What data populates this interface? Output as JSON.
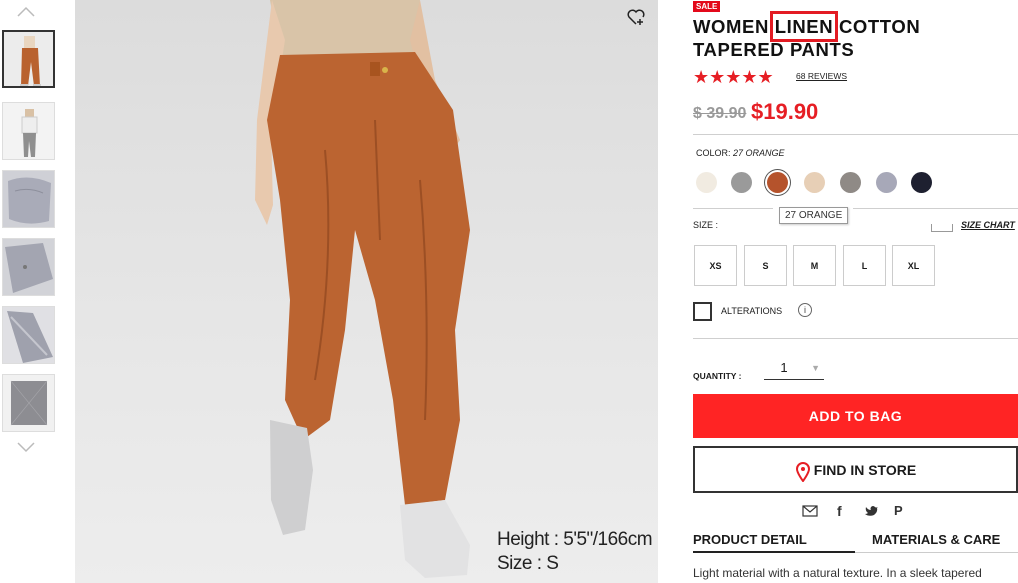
{
  "thumbnails": {
    "up_arrow": "^",
    "down_arrow": "v",
    "count": 6
  },
  "hero": {
    "caption_height": "Height : 5'5\"/166cm",
    "caption_size": "Size : S"
  },
  "product": {
    "sale_badge": "SALE",
    "title_before": "WOMEN ",
    "title_highlight": "LINEN",
    "title_after": " COTTON TAPERED PANTS",
    "stars": "★★★★★",
    "reviews": "68 REVIEWS",
    "old_price": "$ 39.90",
    "price": "$19.90"
  },
  "color": {
    "label": "COLOR:",
    "selected": "27 ORANGE",
    "tooltip": "27 ORANGE",
    "swatches": [
      "#f1ebe1",
      "#9a9a9a",
      "#b5532c",
      "#e7cfb6",
      "#8f8a86",
      "#a7a8b8",
      "#1e2030"
    ]
  },
  "size": {
    "label": "SIZE :",
    "chart_link": "SIZE CHART",
    "options": [
      "XS",
      "S",
      "M",
      "L",
      "XL"
    ]
  },
  "alterations": {
    "label": "ALTERATIONS",
    "info": "i"
  },
  "quantity": {
    "label": "QUANTITY :",
    "value": "1",
    "caret": "▼"
  },
  "actions": {
    "add_to_bag": "ADD TO BAG",
    "find_in_store": "FIND IN STORE"
  },
  "share": {
    "email": "✉",
    "facebook": "f",
    "twitter": "🐦",
    "pinterest": "P"
  },
  "tabs": {
    "detail": "PRODUCT DETAIL",
    "materials": "MATERIALS & CARE"
  },
  "description": "Light material with a natural texture. In a sleek tapered"
}
